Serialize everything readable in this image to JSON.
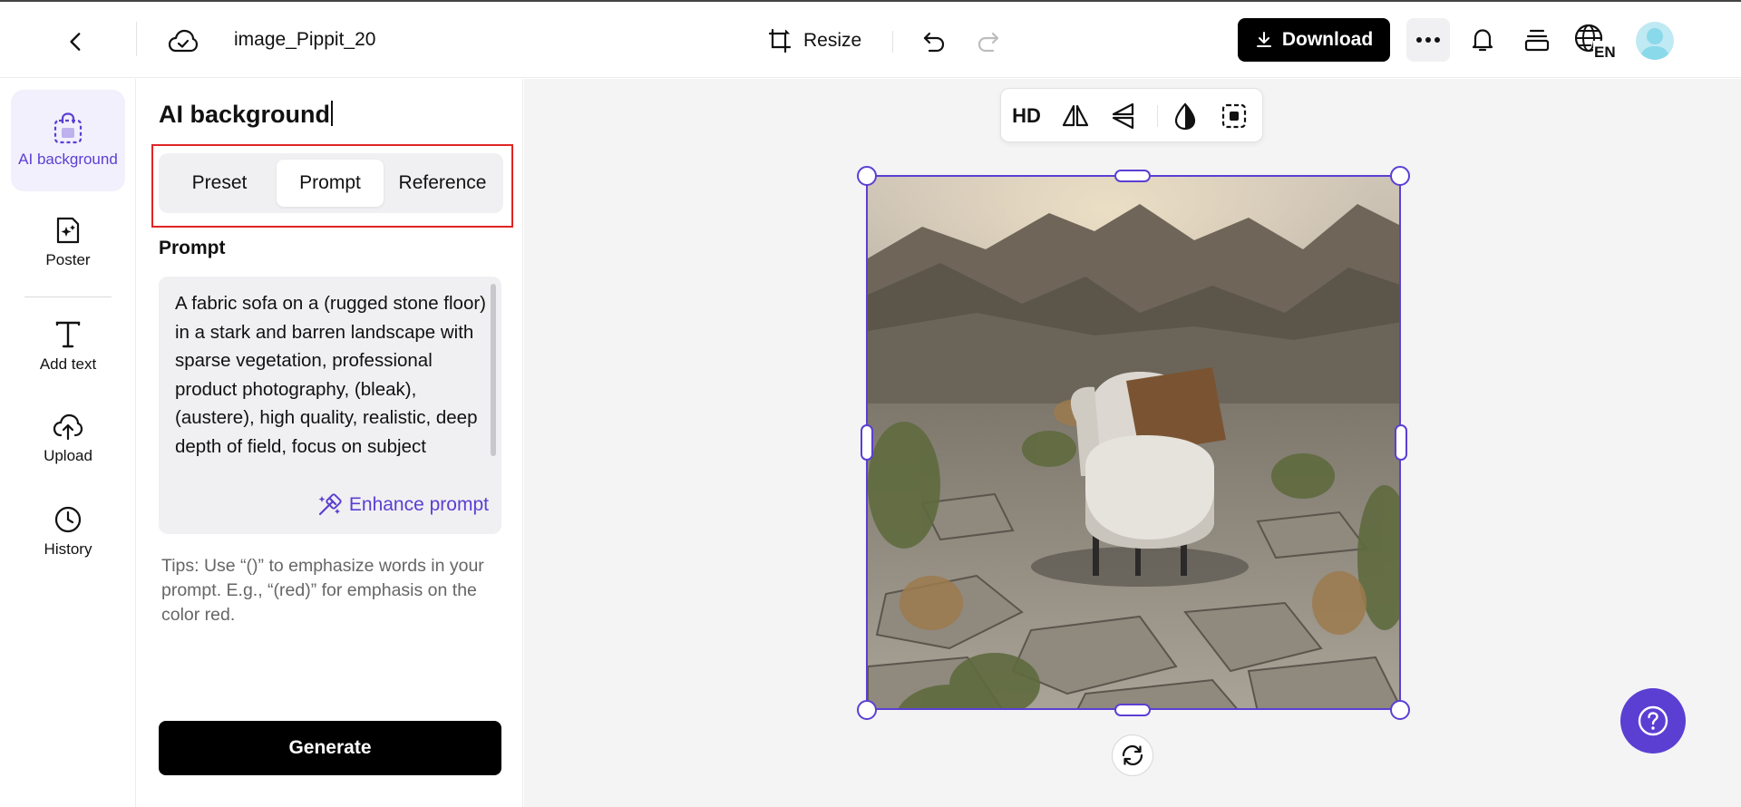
{
  "header": {
    "file_name": "image_Pippit_20",
    "resize_label": "Resize",
    "download_label": "Download",
    "lang_code": "EN"
  },
  "rail": {
    "items": [
      {
        "label": "AI background",
        "icon": "bag-icon",
        "active": true
      },
      {
        "label": "Poster",
        "icon": "poster-icon"
      },
      {
        "label": "Add text",
        "icon": "text-icon"
      },
      {
        "label": "Upload",
        "icon": "upload-cloud-icon"
      },
      {
        "label": "History",
        "icon": "clock-icon"
      }
    ]
  },
  "panel": {
    "title": "AI background",
    "tabs": [
      {
        "label": "Preset"
      },
      {
        "label": "Prompt",
        "active": true
      },
      {
        "label": "Reference"
      }
    ],
    "prompt_label": "Prompt",
    "prompt_text": "A fabric sofa on a (rugged stone floor) in a stark and barren landscape with sparse vegetation, professional product photography, (bleak), (austere), high quality, realistic, deep depth of field, focus on subject",
    "enhance_label": "Enhance prompt",
    "tips": "Tips: Use “()” to emphasize words in your prompt. E.g., “(red)” for emphasis on the color red.",
    "generate_label": "Generate"
  },
  "canvas": {
    "toolbar": {
      "hd_label": "HD"
    }
  },
  "colors": {
    "accent": "#5b3fd3",
    "highlight_outline": "#e02424",
    "canvas_bg": "#f4f4f5"
  }
}
